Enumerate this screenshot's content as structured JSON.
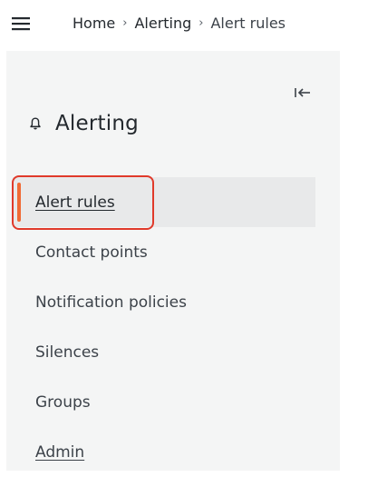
{
  "header": {
    "menu_icon": "hamburger-menu-icon",
    "breadcrumb": [
      {
        "label": "Home"
      },
      {
        "label": "Alerting"
      },
      {
        "label": "Alert rules"
      }
    ],
    "separator": "›"
  },
  "sidebar": {
    "collapse_icon": "collapse-left-icon",
    "section_icon": "bell-icon",
    "section_title": "Alerting",
    "items": [
      {
        "label": "Alert rules",
        "active": true
      },
      {
        "label": "Contact points"
      },
      {
        "label": "Notification policies"
      },
      {
        "label": "Silences"
      },
      {
        "label": "Groups"
      },
      {
        "label": "Admin"
      }
    ]
  },
  "colors": {
    "active_indicator": "#f06a35",
    "highlight_outline": "#e03a2b",
    "sidebar_background": "#f4f5f5",
    "active_item_background": "#e8e9ea"
  }
}
